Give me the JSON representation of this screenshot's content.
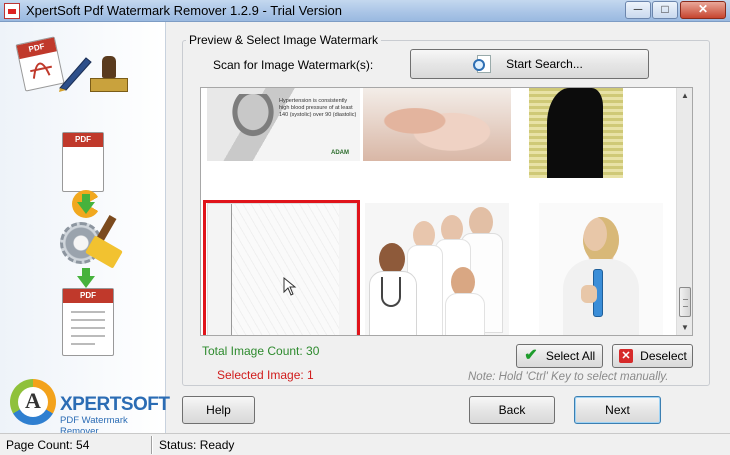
{
  "window": {
    "title": "XpertSoft Pdf Watermark Remover 1.2.9 - Trial Version",
    "minimize_glyph": "─",
    "maximize_glyph": "□",
    "close_glyph": "✕"
  },
  "branding": {
    "logo_letter": "A",
    "logo_name": "XPERTSOFT",
    "logo_subtitle": "PDF Watermark Remover",
    "pdf_badge": "PDF"
  },
  "preview": {
    "group_title": "Preview & Select Image Watermark",
    "scan_label": "Scan for Image Watermark(s):",
    "start_search_label": "Start Search...",
    "thumb_caption_text": "Hypertension is consistently high blood pressure of at least 140 (systolic) over 90 (diastolic)",
    "thumb_caption_brand": "ADAM",
    "scroll_up_glyph": "▲",
    "scroll_down_glyph": "▼"
  },
  "counts": {
    "total_image_count": "Total Image Count: 30",
    "selected_image": "Selected Image: 1",
    "note": "Note: Hold 'Ctrl' Key to select manually."
  },
  "buttons": {
    "select_all": "Select All",
    "deselect": "Deselect",
    "help": "Help",
    "back": "Back",
    "next": "Next",
    "check_glyph": "✔",
    "x_glyph": "✕"
  },
  "statusbar": {
    "page_count": "Page Count: 54",
    "status": "Status: Ready"
  },
  "colors": {
    "selection_red": "#e0131a",
    "count_green": "#2d8a2d",
    "selected_red": "#d01c1c",
    "logo_blue": "#2b6cb4"
  }
}
